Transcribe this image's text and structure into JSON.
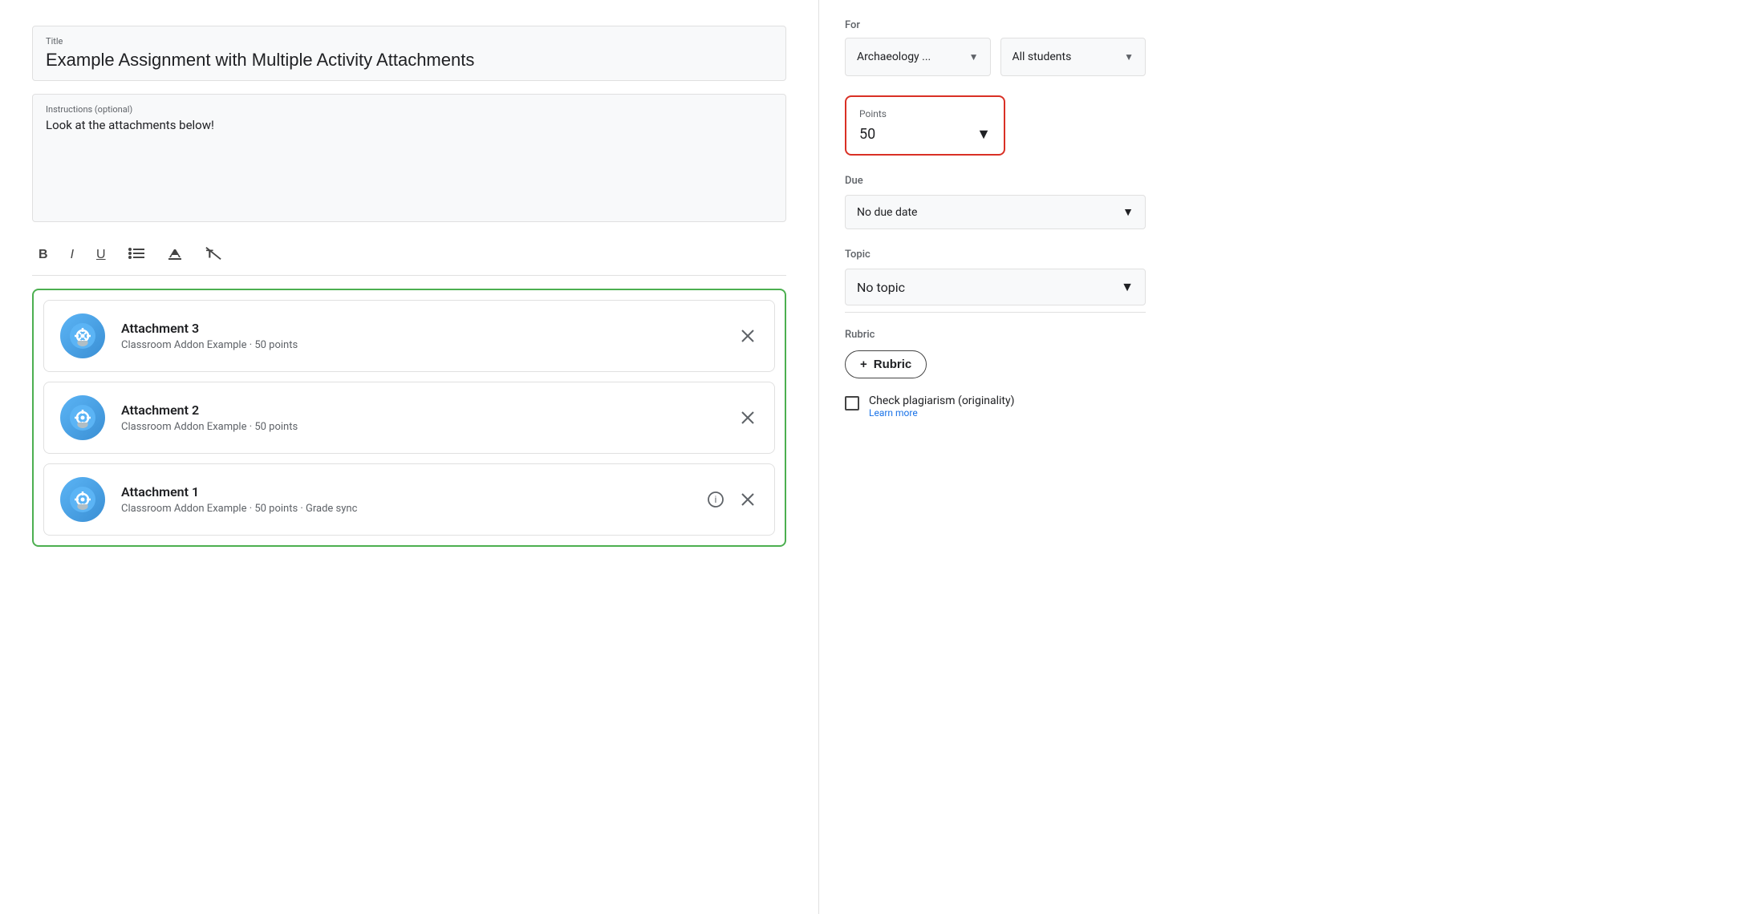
{
  "title_field": {
    "label": "Title",
    "value": "Example Assignment with Multiple Activity Attachments"
  },
  "instructions_field": {
    "label": "Instructions (optional)",
    "value": "Look at the attachments below!"
  },
  "toolbar": {
    "bold": "B",
    "italic": "I",
    "underline": "U",
    "list": "≡",
    "clear": "✕"
  },
  "attachments": [
    {
      "name": "Attachment 3",
      "meta": "Classroom Addon Example · 50 points",
      "has_info": false
    },
    {
      "name": "Attachment 2",
      "meta": "Classroom Addon Example · 50 points",
      "has_info": false
    },
    {
      "name": "Attachment 1",
      "meta": "Classroom Addon Example · 50 points · Grade sync",
      "has_info": true
    }
  ],
  "right_panel": {
    "for_label": "For",
    "class_value": "Archaeology ...",
    "students_value": "All students",
    "points_label": "Points",
    "points_value": "50",
    "due_label": "Due",
    "due_value": "No due date",
    "topic_label": "Topic",
    "topic_value": "No topic",
    "rubric_label": "Rubric",
    "rubric_btn_label": "Rubric",
    "rubric_plus": "+",
    "plagiarism_label": "Check plagiarism (originality)",
    "learn_more": "Learn more"
  }
}
